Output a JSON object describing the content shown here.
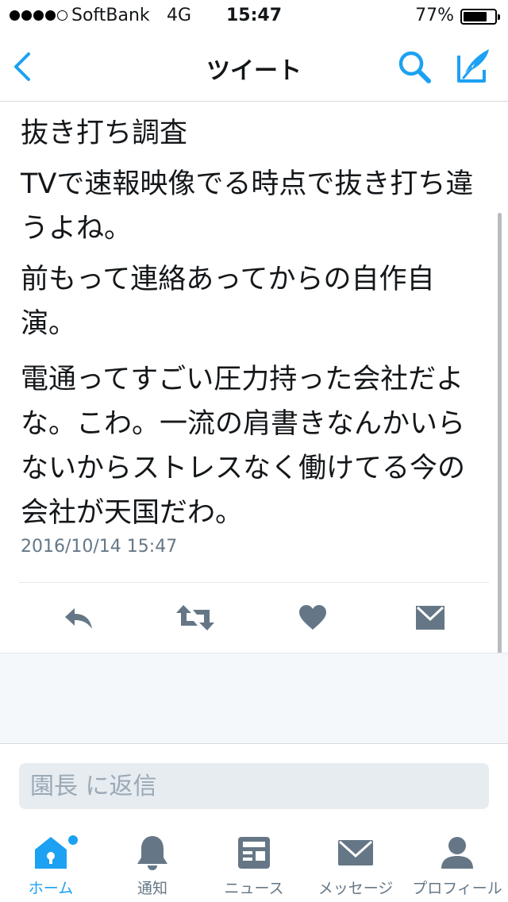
{
  "status_bar": {
    "carrier": "SoftBank",
    "network": "4G",
    "time": "15:47",
    "battery_percent": "77%",
    "battery_level": 0.77
  },
  "nav": {
    "title": "ツイート",
    "back_icon": "chevron-left-icon",
    "search_icon": "search-icon",
    "compose_icon": "compose-icon",
    "accent_color": "#1da1f2"
  },
  "tweet": {
    "paragraphs": [
      "抜き打ち調査",
      "TVで速報映像でる時点で抜き打ち違うよね。",
      "前もって連絡あってからの自作自演。",
      "電通ってすごい圧力持った会社だよな。こわ。一流の肩書きなんかいらないからストレスなく働けてる今の会社が天国だわ。"
    ],
    "timestamp": "2016/10/14 15:47",
    "actions": [
      "reply-icon",
      "retweet-icon",
      "like-icon",
      "direct-message-icon"
    ]
  },
  "reply": {
    "placeholder": "園長 に返信"
  },
  "tab_bar": {
    "tabs": [
      {
        "label": "ホーム",
        "icon": "home-icon",
        "active": true
      },
      {
        "label": "通知",
        "icon": "bell-icon",
        "active": false
      },
      {
        "label": "ニュース",
        "icon": "news-icon",
        "active": false
      },
      {
        "label": "メッセージ",
        "icon": "envelope-icon",
        "active": false
      },
      {
        "label": "プロフィール",
        "icon": "profile-icon",
        "active": false
      }
    ]
  }
}
